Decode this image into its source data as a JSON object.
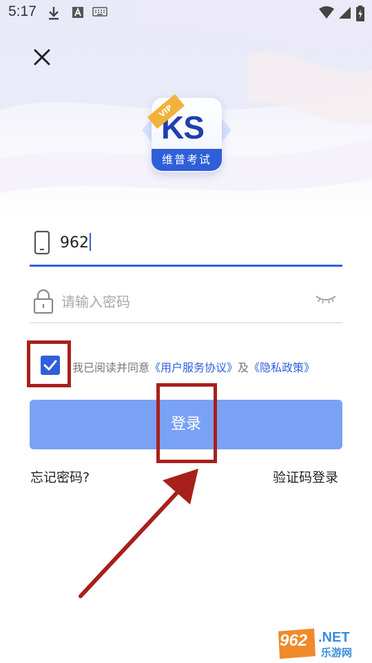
{
  "status_bar": {
    "time": "5:17",
    "icons": [
      "download-icon",
      "a-notification-icon",
      "keyboard-icon",
      "wifi-icon",
      "signal-icon",
      "battery-icon"
    ]
  },
  "header": {
    "close_icon": "close-icon"
  },
  "logo": {
    "letters": "KS",
    "banner_text": "维普考试",
    "badge_text": "VIP"
  },
  "form": {
    "phone_value": "962",
    "password_placeholder": "请输入密码",
    "password_value": ""
  },
  "agreement": {
    "checked": true,
    "prefix": "我已阅读并同意",
    "terms_link": "《用户服务协议》",
    "conjunction": "及",
    "privacy_link": "《隐私政策》"
  },
  "login_button": {
    "label": "登录"
  },
  "links": {
    "forgot_password": "忘记密码?",
    "sms_login": "验证码登录"
  },
  "watermark": {
    "number": "962",
    "domain": ".NET",
    "site": "乐游网"
  },
  "colors": {
    "accent": "#2f5fdc",
    "button": "#7aa2f4",
    "annotation": "#a8201c"
  }
}
